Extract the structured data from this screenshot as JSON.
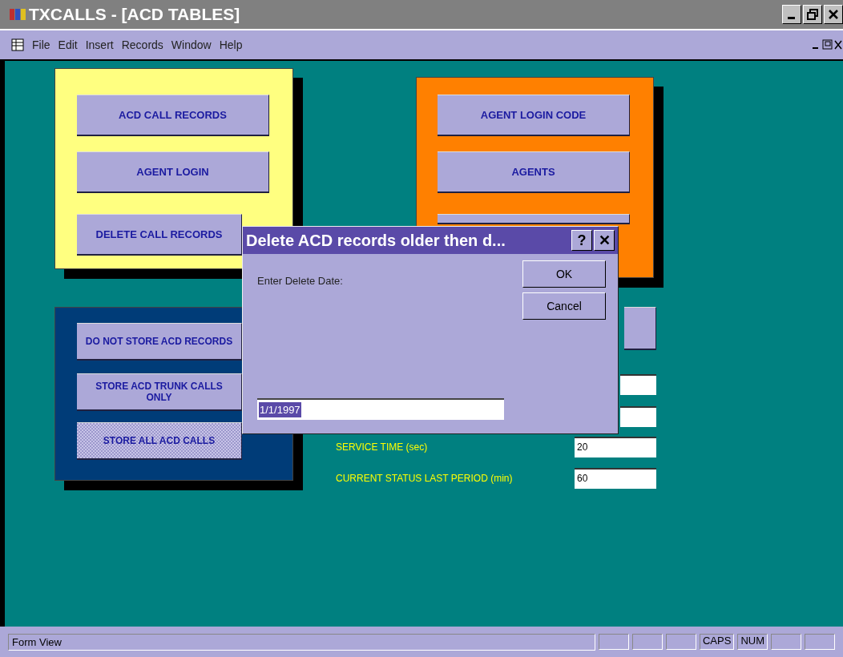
{
  "window": {
    "title": "TXCALLS - [ACD TABLES]"
  },
  "menu": [
    "File",
    "Edit",
    "Insert",
    "Records",
    "Window",
    "Help"
  ],
  "yellow_panel": {
    "buttons": [
      "ACD CALL RECORDS",
      "AGENT LOGIN",
      "DELETE CALL RECORDS"
    ]
  },
  "orange_panel": {
    "buttons": [
      "AGENT LOGIN CODE",
      "AGENTS"
    ]
  },
  "storage_options": [
    {
      "label": "DO NOT STORE ACD RECORDS",
      "selected": false
    },
    {
      "label": "STORE ACD TRUNK CALLS ONLY",
      "selected": false
    },
    {
      "label": "STORE ALL ACD CALLS",
      "selected": true
    }
  ],
  "settings": [
    {
      "label": "SERVICE TIME (sec)",
      "value": "20"
    },
    {
      "label": "CURRENT STATUS LAST PERIOD (min)",
      "value": "60"
    }
  ],
  "dialog": {
    "title": "Delete ACD records older then d...",
    "help": "?",
    "close": "✕",
    "prompt": "Enter Delete Date:",
    "value": "1/1/1997",
    "buttons": [
      "OK",
      "Cancel"
    ]
  },
  "status_bar": {
    "text": "Form View",
    "indicators": [
      "CAPS",
      "NUM"
    ]
  }
}
